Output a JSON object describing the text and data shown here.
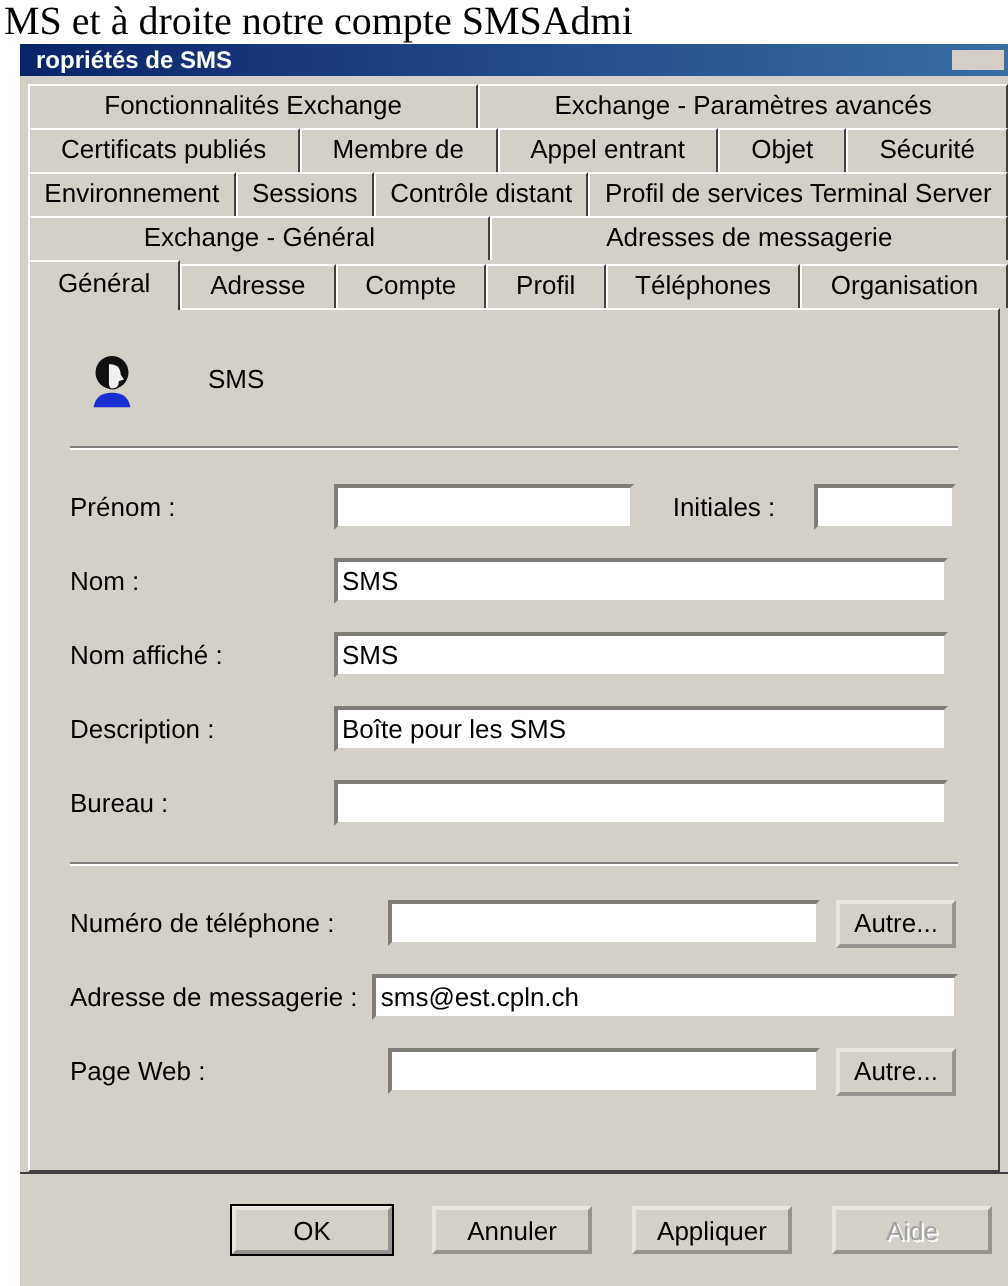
{
  "page_text": "MS et à droite notre compte SMSAdmi",
  "window": {
    "title": "ropriétés de SMS"
  },
  "tab_rows": [
    [
      {
        "label": "Fonctionnalités Exchange",
        "selected": false
      },
      {
        "label": "Exchange - Paramètres avancés",
        "selected": false
      }
    ],
    [
      {
        "label": "Certificats publiés",
        "selected": false
      },
      {
        "label": "Membre de",
        "selected": false
      },
      {
        "label": "Appel entrant",
        "selected": false
      },
      {
        "label": "Objet",
        "selected": false
      },
      {
        "label": "Sécurité",
        "selected": false
      }
    ],
    [
      {
        "label": "Environnement",
        "selected": false
      },
      {
        "label": "Sessions",
        "selected": false
      },
      {
        "label": "Contrôle distant",
        "selected": false
      },
      {
        "label": "Profil de services Terminal Server",
        "selected": false
      }
    ],
    [
      {
        "label": "Exchange - Général",
        "selected": false
      },
      {
        "label": "Adresses de messagerie",
        "selected": false
      }
    ],
    [
      {
        "label": "Général",
        "selected": true
      },
      {
        "label": "Adresse",
        "selected": false
      },
      {
        "label": "Compte",
        "selected": false
      },
      {
        "label": "Profil",
        "selected": false
      },
      {
        "label": "Téléphones",
        "selected": false
      },
      {
        "label": "Organisation",
        "selected": false
      }
    ]
  ],
  "header": {
    "name": "SMS"
  },
  "sections": [
    [
      {
        "label": "Prénom :",
        "extra": {
          "label": "Initiales :"
        }
      },
      {
        "label": "Nom :",
        "value": "SMS"
      },
      {
        "label": "Nom affiché :",
        "value": "SMS"
      },
      {
        "label": "Description :",
        "value": "Boîte pour les SMS"
      },
      {
        "label": "Bureau :"
      }
    ],
    [
      {
        "label": "Numéro de téléphone :",
        "button": "Autre..."
      },
      {
        "label": "Adresse de messagerie :",
        "value": "sms@est.cpln.ch"
      },
      {
        "label": "Page Web :",
        "button": "Autre..."
      }
    ]
  ],
  "buttons": [
    {
      "label": "OK",
      "disabled": false,
      "default": true
    },
    {
      "label": "Annuler",
      "disabled": false,
      "default": false
    },
    {
      "label": "Appliquer",
      "disabled": false,
      "default": false
    },
    {
      "label": "Aide",
      "disabled": true,
      "default": false
    }
  ]
}
